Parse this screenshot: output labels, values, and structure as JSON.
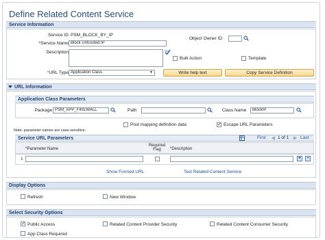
{
  "page": {
    "title": "Define Related Content Service"
  },
  "service_info": {
    "header": "Service Information",
    "service_id_label": "Service ID",
    "service_id_value": "PSM_BLOCK_BY_IP",
    "object_owner_label": "Object Owner ID",
    "service_name_label": "*Service Name",
    "service_name_value": "Block Untrusted IP",
    "description_label": "Description",
    "description_value": "",
    "bulk_action_label": "Bulk Action",
    "template_label": "Template",
    "url_type_label": "*URL Type",
    "url_type_value": "Application Class",
    "write_help_label": "Write help text",
    "copy_service_label": "Copy Service Definition"
  },
  "url_info": {
    "header": "URL Information",
    "app_class_header": "Application Class Parameters",
    "package_label": "Package",
    "package_value": "PSM_APP_FIREWALL",
    "path_label": "Path",
    "path_value": "",
    "class_name_label": "Class Name",
    "class_name_value": "BlockIP",
    "note": "Note: parameter names are case-sensitive.",
    "post_mapping_label": "Post mapping definition data",
    "escape_url_label": "Escape URL Parameters",
    "params_header": "Service URL Parameters",
    "pager_first": "First",
    "pager_range": "1 of 1",
    "pager_last": "Last",
    "col_param_name": "*Parameter Name",
    "col_required_flag": "Required Flag",
    "col_description": "*Description",
    "row_number": "1",
    "row_param_value": "",
    "row_desc_value": "",
    "show_formed_url": "Show Formed URL",
    "test_service": "Test Related Content Service"
  },
  "display_options": {
    "header": "Display Options",
    "refresh_label": "Refresh",
    "new_window_label": "New Window"
  },
  "security_options": {
    "header": "Select Security Options",
    "public_access_label": "Public Access",
    "provider_security_label": "Related Content Provider Security",
    "consumer_security_label": "Related Content Consumer Security",
    "cut_off_label": "App Class Required"
  },
  "checks": {
    "bulk_action": false,
    "template": false,
    "post_mapping": false,
    "escape_url": true,
    "required_flag": false,
    "refresh": false,
    "new_window": false,
    "public_access": true,
    "provider_security": false,
    "consumer_security": false
  },
  "colors": {
    "accent": "#2a4d7a",
    "header_bg": "#dbe4f0",
    "button_bg": "#f6d68f",
    "link": "#1a4f95"
  },
  "icons": [
    "search-icon",
    "spellcheck-icon",
    "chevron-down-icon",
    "pager-prev-icon",
    "pager-next-icon",
    "add-row-icon",
    "delete-row-icon",
    "grid-personalize-icon",
    "collapse-icon"
  ]
}
